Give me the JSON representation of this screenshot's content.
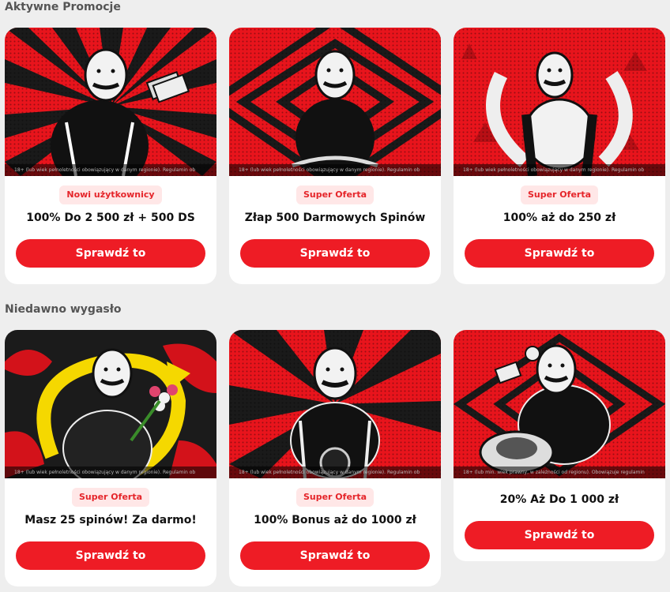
{
  "sections": {
    "active_title": "Aktywne Promocje",
    "expired_title": "Niedawno wygasło"
  },
  "cta_label": "Sprawdź to",
  "colors": {
    "brand_red": "#ee1c25",
    "badge_bg": "#ffe7e7",
    "badge_text": "#e5252a",
    "page_bg": "#eeeeee"
  },
  "active": [
    {
      "badge": "Nowi użytkownicy",
      "title": "100% Do 2 500 zł + 500 DS",
      "disclaimer": "18+ (lub wiek pełnoletności obowiązujący w danym regionie). Regulamin ob",
      "button": "Sprawdź to"
    },
    {
      "badge": "Super Oferta",
      "title": "Złap 500 Darmowych Spinów",
      "disclaimer": "18+ (lub wiek pełnoletności obowiązujący w danym regionie). Regulamin ob",
      "button": "Sprawdź to"
    },
    {
      "badge": "Super Oferta",
      "title": "100% aż do 250 zł",
      "disclaimer": "18+ (lub wiek pełnoletności obowiązujący w danym regionie). Regulamin ob",
      "button": "Sprawdź to"
    }
  ],
  "expired": [
    {
      "badge": "Super Oferta",
      "title": "Masz 25 spinów! Za darmo!",
      "disclaimer": "18+ (lub wiek pełnoletności obowiązujący w danym regionie). Regulamin ob",
      "button": "Sprawdź to"
    },
    {
      "badge": "Super Oferta",
      "title": "100% Bonus aż do 1000 zł",
      "disclaimer": "18+ (lub wiek pełnoletności obowiązujący w danym regionie). Regulamin ob",
      "button": "Sprawdź to"
    },
    {
      "title": "20% Aż Do 1 000 zł",
      "disclaimer": "18+ (lub min. wiek prawny, w zależności od regionu). Obowiązuje regulamin",
      "button": "Sprawdź to"
    }
  ]
}
